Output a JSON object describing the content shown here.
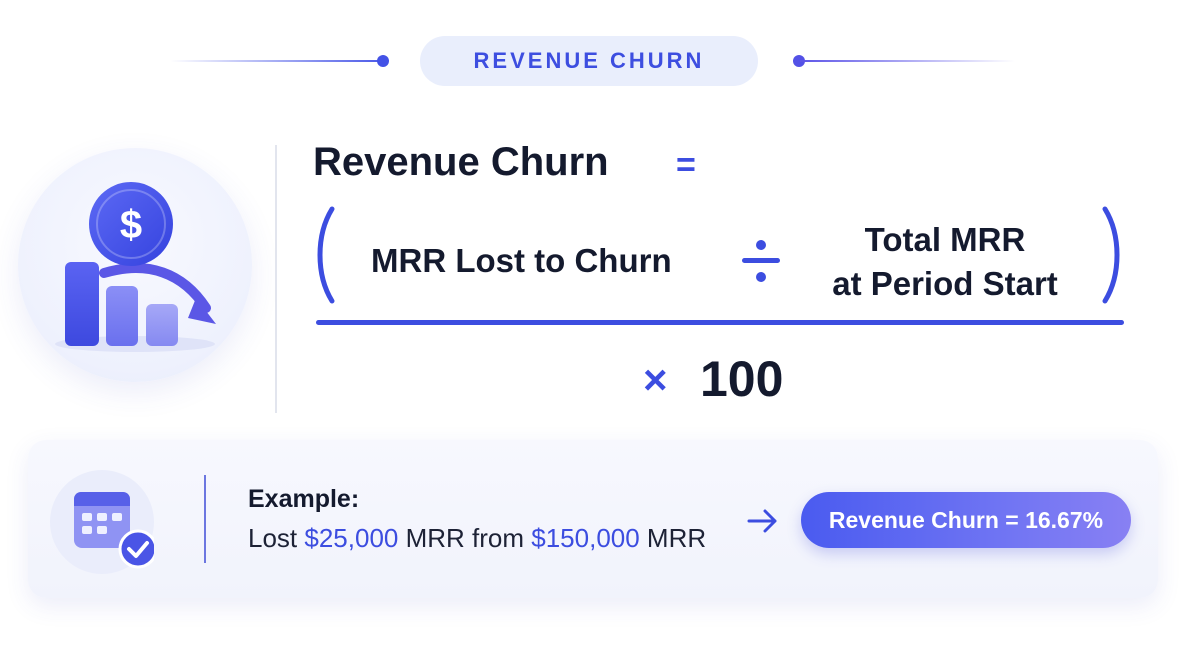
{
  "header": {
    "title": "REVENUE CHURN"
  },
  "formula": {
    "lhs": "Revenue Churn",
    "equals": "=",
    "numerator_term": "MRR Lost to Churn",
    "operator": "÷",
    "denominator_term_line1": "Total MRR",
    "denominator_term_line2": "at Period Start",
    "times": "×",
    "multiplier": "100"
  },
  "example": {
    "label": "Example:",
    "prefix": "Lost ",
    "amount_lost": "$25,000",
    "middle": " MRR from ",
    "amount_start": "$150,000",
    "suffix": " MRR",
    "arrow": "→",
    "result": "Revenue Churn = 16.67%"
  },
  "icons": {
    "main": "revenue-decline-icon",
    "coin_symbol": "$",
    "calendar": "calendar-check-icon"
  },
  "colors": {
    "accent": "#3c4de0",
    "text_dark": "#141a2e",
    "pill_bg": "#e9eefc",
    "result_gradient_start": "#4a5bf0",
    "result_gradient_end": "#8880f3"
  }
}
